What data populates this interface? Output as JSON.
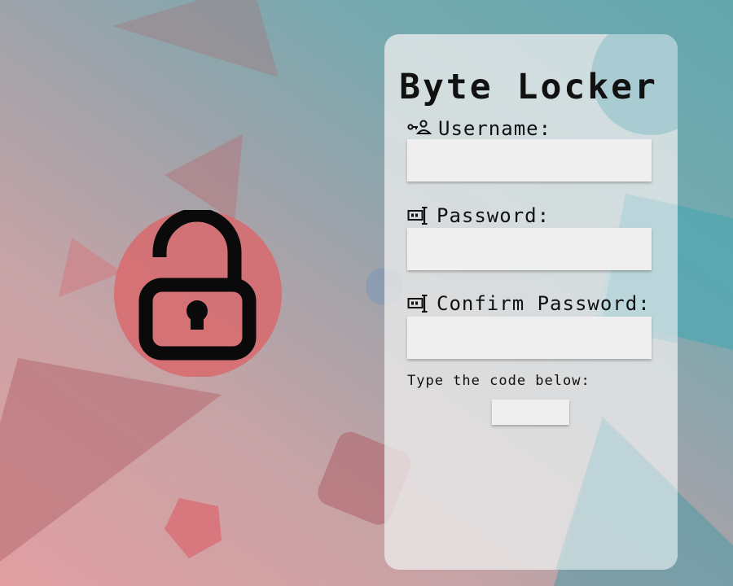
{
  "app": {
    "title": "Byte Locker"
  },
  "form": {
    "username_label": "Username:",
    "username_value": "",
    "password_label": "Password:",
    "password_value": "",
    "confirm_label": "Confirm Password:",
    "confirm_value": "",
    "code_label": "Type the code below:",
    "code_value": ""
  },
  "icons": {
    "lock": "unlocked-padlock-icon",
    "username": "user-key-icon",
    "password": "password-key-icon",
    "confirm": "password-key-icon"
  },
  "colors": {
    "lock_circle": "#d96a6c",
    "card_bg": "#ececec",
    "text": "#111111"
  }
}
